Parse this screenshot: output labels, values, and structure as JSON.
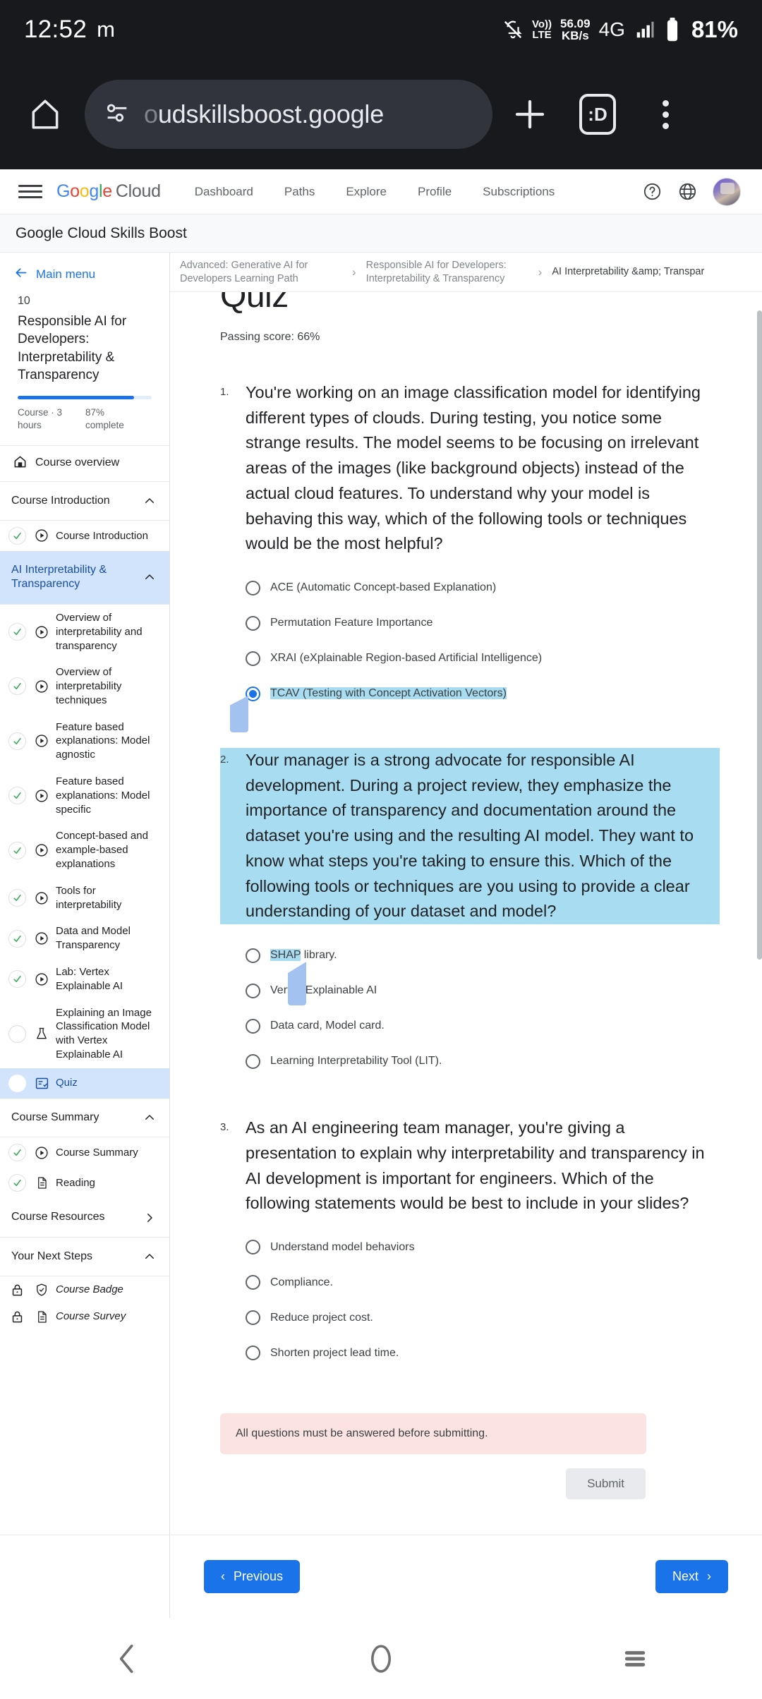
{
  "status_bar": {
    "time": "12:52",
    "app_glyph": "m",
    "volte_label_top": "Vo))",
    "volte_label_bottom": "LTE",
    "net_speed": "56.09",
    "net_speed_unit": "KB/s",
    "network_type": "4G",
    "battery": "81%"
  },
  "browser": {
    "url_faded_prefix": "o",
    "url": "udskillsboost.google",
    "tab_count": ":D",
    "icons": {
      "home": "home-icon",
      "site_settings": "tune-icon",
      "new_tab": "plus-icon",
      "menu": "three-dot-menu-icon"
    }
  },
  "gcnav": {
    "logo": {
      "g1": "G",
      "o1": "o",
      "o2": "o",
      "g2": "g",
      "l": "l",
      "e": "e",
      "cloud": "Cloud"
    },
    "links": [
      "Dashboard",
      "Paths",
      "Explore",
      "Profile",
      "Subscriptions"
    ],
    "help_icon": "help-circle-icon",
    "language_icon": "globe-icon",
    "avatar": "user-avatar"
  },
  "subheader": {
    "title": "Google Cloud Skills Boost"
  },
  "breadcrumb": {
    "items": [
      "Advanced: Generative AI for Developers Learning Path",
      "Responsible AI for Developers: Interpretability & Transparency",
      "AI Interpretability &amp; Transpar"
    ],
    "separator": "›"
  },
  "sidebar": {
    "back_label": "Main menu",
    "course_number": "10",
    "course_title": "Responsible AI for Developers: Interpretability & Transparency",
    "progress_percent": 87,
    "stat_duration": "Course · 3 hours",
    "stat_complete": "87% complete",
    "overview_label": "Course overview",
    "sections": [
      {
        "label": "Course Introduction",
        "active": false,
        "chevron": "chevron-up-icon",
        "items": [
          {
            "label": "Course Introduction",
            "state": "complete",
            "icon": "play-circle-icon"
          }
        ]
      },
      {
        "label": "AI Interpretability & Transparency",
        "active": true,
        "chevron": "chevron-up-icon",
        "items": [
          {
            "label": "Overview of interpretability and transparency",
            "state": "complete",
            "icon": "play-circle-icon"
          },
          {
            "label": "Overview of interpretability techniques",
            "state": "complete",
            "icon": "play-circle-icon"
          },
          {
            "label": "Feature based explanations: Model agnostic",
            "state": "complete",
            "icon": "play-circle-icon"
          },
          {
            "label": "Feature based explanations: Model specific",
            "state": "complete",
            "icon": "play-circle-icon"
          },
          {
            "label": "Concept-based and example-based explanations",
            "state": "complete",
            "icon": "play-circle-icon"
          },
          {
            "label": "Tools for interpretability",
            "state": "complete",
            "icon": "play-circle-icon"
          },
          {
            "label": "Data and Model Transparency",
            "state": "complete",
            "icon": "play-circle-icon"
          },
          {
            "label": "Lab: Vertex Explainable AI",
            "state": "complete",
            "icon": "play-circle-icon"
          },
          {
            "label": "Explaining an Image Classification Model with Vertex Explainable AI",
            "state": "incomplete",
            "icon": "flask-icon"
          },
          {
            "label": "Quiz",
            "state": "current",
            "icon": "quiz-icon",
            "active": true
          }
        ]
      },
      {
        "label": "Course Summary",
        "active": false,
        "chevron": "chevron-up-icon",
        "items": [
          {
            "label": "Course Summary",
            "state": "complete",
            "icon": "play-circle-icon"
          },
          {
            "label": "Reading",
            "state": "complete",
            "icon": "document-icon"
          }
        ]
      },
      {
        "label": "Course Resources",
        "active": false,
        "chevron": "chevron-right-icon",
        "items": []
      },
      {
        "label": "Your Next Steps",
        "active": false,
        "chevron": "chevron-up-icon",
        "items": [
          {
            "label": "Course Badge",
            "state": "locked",
            "icon": "shield-check-icon"
          },
          {
            "label": "Course Survey",
            "state": "locked",
            "icon": "document-icon"
          }
        ]
      }
    ]
  },
  "quiz": {
    "title": "Quiz",
    "passing_score": "Passing score: 66%",
    "questions": [
      {
        "number": "1.",
        "text": "You're working on an image classification model for identifying different types of clouds. During testing, you notice some strange results. The model seems to be focusing on irrelevant areas of the images (like background objects) instead of the actual cloud features. To understand why your model is behaving this way, which of the following tools or techniques would be the most helpful?",
        "selected_index": 3,
        "text_selected": false,
        "options": [
          "ACE (Automatic Concept-based Explanation)",
          "Permutation Feature Importance",
          "XRAI (eXplainable Region-based Artificial Intelligence)",
          "TCAV (Testing with Concept Activation Vectors)"
        ]
      },
      {
        "number": "2.",
        "text": "Your manager is a strong advocate for responsible AI development. During a project review, they emphasize the importance of transparency and documentation around the dataset you're using and the resulting AI model. They want to know what steps you're taking to ensure this. Which of the following tools or techniques are you using to provide a clear understanding of your dataset and model?",
        "selected_index": -1,
        "text_selected": true,
        "options": [
          "SHAP library.",
          "Vertex Explainable AI",
          "Data card, Model card.",
          "Learning Interpretability Tool (LIT)."
        ],
        "partial_highlight": {
          "option_index": 0,
          "highlighted_text": "SHAP",
          "rest_text": " library."
        }
      },
      {
        "number": "3.",
        "text": "As an AI engineering team manager, you're giving a presentation to explain why interpretability and transparency in AI development is important for engineers. Which of the following statements would be best to include in your slides?",
        "selected_index": -1,
        "text_selected": false,
        "options": [
          "Understand model behaviors",
          "Compliance.",
          "Reduce project cost.",
          "Shorten project lead time."
        ]
      }
    ],
    "error_message": "All questions must be answered before submitting.",
    "submit_label": "Submit"
  },
  "footer": {
    "previous_label": "Previous",
    "next_label": "Next",
    "prev_icon": "chevron-left-icon",
    "next_icon": "chevron-right-icon"
  },
  "android_nav": {
    "back": "back-icon",
    "home": "home-circle-icon",
    "recents": "recents-icon"
  },
  "colors": {
    "accent_blue": "#1a73e8",
    "selection_cyan": "#a8dcf0",
    "handle_blue": "#a3c2f0",
    "error_pink": "#fbe3e1",
    "active_row": "#d2e3fc"
  }
}
